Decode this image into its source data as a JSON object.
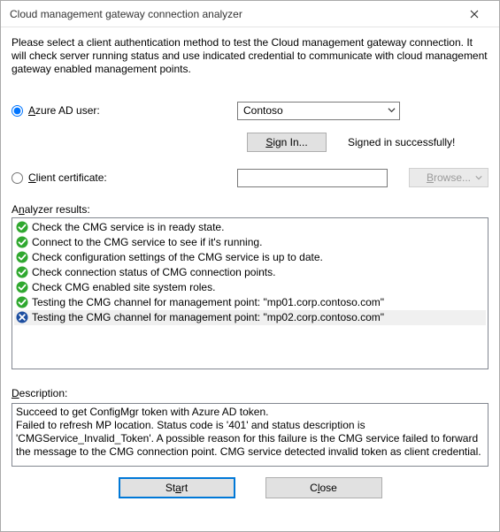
{
  "window": {
    "title": "Cloud management gateway connection analyzer"
  },
  "instructions": "Please select a client authentication method to test the Cloud management gateway connection. It will check server running status and use indicated credential to communicate with cloud management gateway enabled management points.",
  "auth": {
    "azure_ad_label": "Azure AD user:",
    "azure_ad_selected": true,
    "tenant_selected": "Contoso",
    "sign_in_label": "Sign In...",
    "signed_in_status": "Signed in successfully!",
    "client_cert_label": "Client certificate:",
    "client_cert_selected": false,
    "client_cert_value": "",
    "browse_label": "Browse..."
  },
  "results_label": "Analyzer results:",
  "results": [
    {
      "status": "ok",
      "text": "Check the CMG service is in ready state."
    },
    {
      "status": "ok",
      "text": "Connect to the CMG service to see if it's running."
    },
    {
      "status": "ok",
      "text": "Check configuration settings of the CMG service is up to date."
    },
    {
      "status": "ok",
      "text": "Check connection status of CMG connection points."
    },
    {
      "status": "ok",
      "text": "Check CMG enabled site system roles."
    },
    {
      "status": "ok",
      "text": "Testing the CMG channel for management point:",
      "host": "\"mp01.corp.contoso.com\""
    },
    {
      "status": "fail",
      "text": "Testing the CMG channel for management point:",
      "host": "\"mp02.corp.contoso.com\"",
      "selected": true
    }
  ],
  "description_label": "Description:",
  "description": "Succeed to get ConfigMgr token with Azure AD token.\nFailed to refresh MP location. Status code is '401' and status description is 'CMGService_Invalid_Token'. A possible reason for this failure is the CMG service failed to forward the message to the CMG connection point. CMG service detected invalid token as client credential.",
  "buttons": {
    "start": "Start",
    "close": "Close"
  },
  "mnemonics": {
    "azure": "A",
    "sign_in": "S",
    "client_cert": "C",
    "browse": "B",
    "results": "n",
    "description": "D",
    "start": "a",
    "close": "l"
  }
}
